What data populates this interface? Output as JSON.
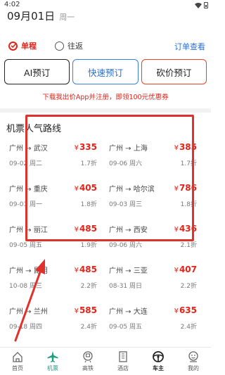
{
  "status_bar": {
    "time": "4:02"
  },
  "header": {
    "date": "09月01日",
    "weekday": "周一"
  },
  "trip_type": {
    "options": [
      {
        "label": "单程",
        "selected": true
      },
      {
        "label": "往返",
        "selected": false
      }
    ],
    "order_link": "订单查看"
  },
  "actions": {
    "ai": "AI预订",
    "fast": "快速预订",
    "bargain": "砍价预订"
  },
  "promo_text": "下载我出价App并注册，即领100元优惠券",
  "section_title": "机票人气路线",
  "currency": "¥",
  "routes": [
    {
      "route": "广州 → 武汉",
      "price": "335",
      "date": "09-02 周二",
      "discount": "1.7折"
    },
    {
      "route": "广州 → 上海",
      "price": "385",
      "date": "09-06 周六",
      "discount": "1.7折"
    },
    {
      "route": "广州 → 重庆",
      "price": "405",
      "date": "09-01 周一",
      "discount": "1.8折"
    },
    {
      "route": "广州 → 哈尔滨",
      "price": "786",
      "date": "09-03 周三",
      "discount": "1.8折"
    },
    {
      "route": "广州 → 丽江",
      "price": "485",
      "date": "09-05 周五",
      "discount": "1.9折"
    },
    {
      "route": "广州 → 西安",
      "price": "436",
      "date": "09-06 周六",
      "discount": "2.1折"
    },
    {
      "route": "广州 → 昆明",
      "price": "485",
      "date": "10-08 周三",
      "discount": "2.2折"
    },
    {
      "route": "广州 → 三亚",
      "price": "407",
      "date": "08-31 周日",
      "discount": "2.2折"
    },
    {
      "route": "广州 → 兰州",
      "price": "585",
      "date": "09-18 周四",
      "discount": "2.4折"
    },
    {
      "route": "广州 → 大连",
      "price": "635",
      "date": "09-05 周五",
      "discount": "2.4折"
    }
  ],
  "bottom_nav": [
    {
      "label": "首页",
      "icon": "home-icon"
    },
    {
      "label": "机票",
      "icon": "plane-icon",
      "active": true
    },
    {
      "label": "高铁",
      "icon": "train-icon"
    },
    {
      "label": "酒店",
      "icon": "hotel-icon"
    },
    {
      "label": "车主",
      "icon": "steering-wheel-icon"
    },
    {
      "label": "我的",
      "icon": "profile-icon"
    }
  ],
  "colors": {
    "accent_red": "#e2231a",
    "link_blue": "#2b6fd6",
    "nav_active": "#1e9d84",
    "annotation_red": "#e0312c"
  }
}
